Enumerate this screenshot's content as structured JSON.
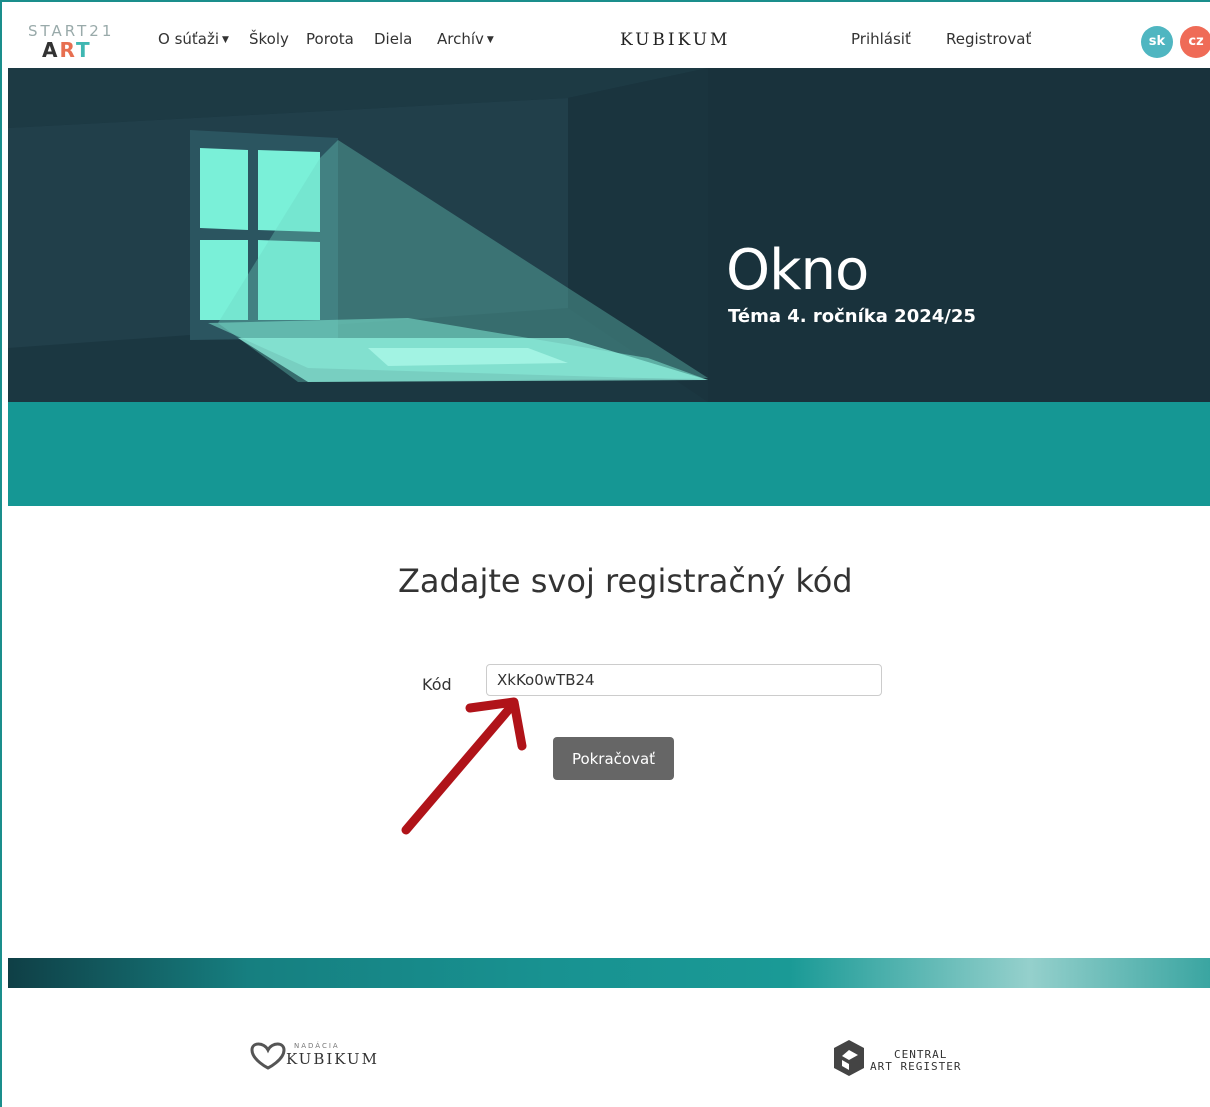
{
  "nav": {
    "logo_top": "START21",
    "logo_a": "A",
    "logo_r": "R",
    "logo_t": "T",
    "items": [
      {
        "label": "O súťaži",
        "dropdown": true
      },
      {
        "label": "Školy",
        "dropdown": false
      },
      {
        "label": "Porota",
        "dropdown": false
      },
      {
        "label": "Diela",
        "dropdown": false
      },
      {
        "label": "Archív",
        "dropdown": true
      }
    ],
    "brand": "KUBIKUM",
    "login": "Prihlásiť",
    "register": "Registrovať",
    "lang_sk": "sk",
    "lang_cz": "cz",
    "lang_sk_color": "#4fb6c1",
    "lang_cz_color": "#ef6b57"
  },
  "hero": {
    "title": "Okno",
    "subtitle": "Téma 4. ročníka 2024/25"
  },
  "form": {
    "heading": "Zadajte svoj registračný kód",
    "label": "Kód",
    "value": "XkKo0wTB24",
    "button": "Pokračovať"
  },
  "footer": {
    "left_logo_small": "NADÁCIA",
    "left_logo": "KUBIKUM",
    "right_logo_line1": "CENTRAL",
    "right_logo_line2": "ART REGISTER"
  },
  "colors": {
    "accent": "#159794",
    "hero_bg": "#19323c",
    "button": "#666666",
    "annotation_arrow": "#b01319"
  }
}
